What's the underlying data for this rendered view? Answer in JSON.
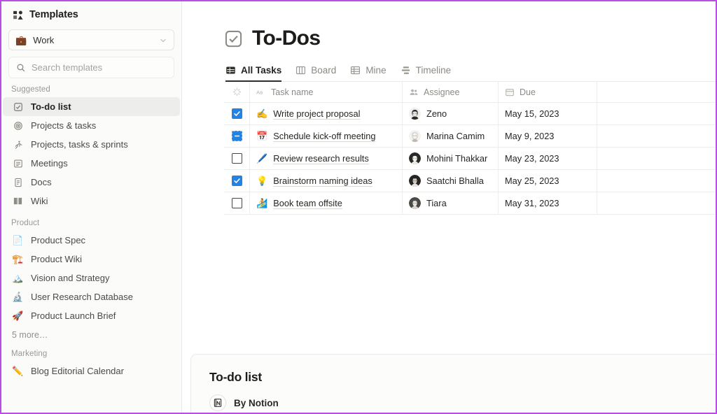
{
  "sidebar": {
    "header": {
      "title": "Templates",
      "icon": "templates-icon"
    },
    "workspace_select": {
      "emoji": "💼",
      "label": "Work",
      "chevron": "chevron-down-icon"
    },
    "search": {
      "placeholder": "Search templates",
      "value": "",
      "icon": "search-icon"
    },
    "groups": [
      {
        "label": "Suggested",
        "items": [
          {
            "label": "To-do list",
            "icon": "checkbox-square-icon",
            "active": true
          },
          {
            "label": "Projects & tasks",
            "icon": "target-icon",
            "active": false
          },
          {
            "label": "Projects, tasks & sprints",
            "icon": "runner-icon",
            "active": false
          },
          {
            "label": "Meetings",
            "icon": "note-lines-icon",
            "active": false
          },
          {
            "label": "Docs",
            "icon": "document-icon",
            "active": false
          },
          {
            "label": "Wiki",
            "icon": "open-book-icon",
            "active": false
          }
        ]
      },
      {
        "label": "Product",
        "items": [
          {
            "label": "Product Spec",
            "icon": "📄",
            "active": false
          },
          {
            "label": "Product Wiki",
            "icon": "🏗️",
            "active": false
          },
          {
            "label": "Vision and Strategy",
            "icon": "🏔️",
            "active": false
          },
          {
            "label": "User Research Database",
            "icon": "🔬",
            "active": false
          },
          {
            "label": "Product Launch Brief",
            "icon": "🚀",
            "active": false
          }
        ],
        "more": "5 more…"
      },
      {
        "label": "Marketing",
        "items": [
          {
            "label": "Blog Editorial Calendar",
            "icon": "✏️",
            "active": false
          }
        ]
      }
    ]
  },
  "main": {
    "page": {
      "title": "To-Dos",
      "icon": "checkbox-square-icon"
    },
    "tabs": [
      {
        "label": "All Tasks",
        "icon": "table-icon",
        "active": true
      },
      {
        "label": "Board",
        "icon": "board-icon",
        "active": false
      },
      {
        "label": "Mine",
        "icon": "grid-icon",
        "active": false
      },
      {
        "label": "Timeline",
        "icon": "timeline-icon",
        "active": false
      }
    ],
    "table": {
      "columns": [
        {
          "label": "",
          "icon": "loading-spinner-icon"
        },
        {
          "label": "Task name",
          "icon": "text-aa-icon"
        },
        {
          "label": "Assignee",
          "icon": "people-icon"
        },
        {
          "label": "Due",
          "icon": "calendar-icon"
        },
        {
          "label": "",
          "icon": ""
        }
      ],
      "rows": [
        {
          "checkbox": "checked",
          "emoji": "✍️",
          "task": "Write project proposal",
          "assignee": "Zeno",
          "avatar": "avatar-zeno",
          "due": "May 15, 2023"
        },
        {
          "checkbox": "indeterminate",
          "emoji": "📅",
          "task": "Schedule kick-off meeting",
          "assignee": "Marina Camim",
          "avatar": "avatar-marina",
          "due": "May 9, 2023"
        },
        {
          "checkbox": "unchecked",
          "emoji": "🖊️",
          "task": "Review research results",
          "assignee": "Mohini Thakkar",
          "avatar": "avatar-mohini",
          "due": "May 23, 2023"
        },
        {
          "checkbox": "checked",
          "emoji": "💡",
          "task": "Brainstorm naming ideas",
          "assignee": "Saatchi Bhalla",
          "avatar": "avatar-saatchi",
          "due": "May 25, 2023"
        },
        {
          "checkbox": "unchecked",
          "emoji": "🏄",
          "task": "Book team offsite",
          "assignee": "Tiara",
          "avatar": "avatar-tiara",
          "due": "May 31, 2023"
        }
      ]
    },
    "bottom_card": {
      "title": "To-do list",
      "by_label": "By Notion",
      "logo": "notion-logo-icon"
    }
  },
  "colors": {
    "accent_blue": "#2383e2",
    "frame_purple": "#b94ee0",
    "sidebar_bg": "#fbfbfa",
    "active_item_bg": "#ededeb"
  }
}
